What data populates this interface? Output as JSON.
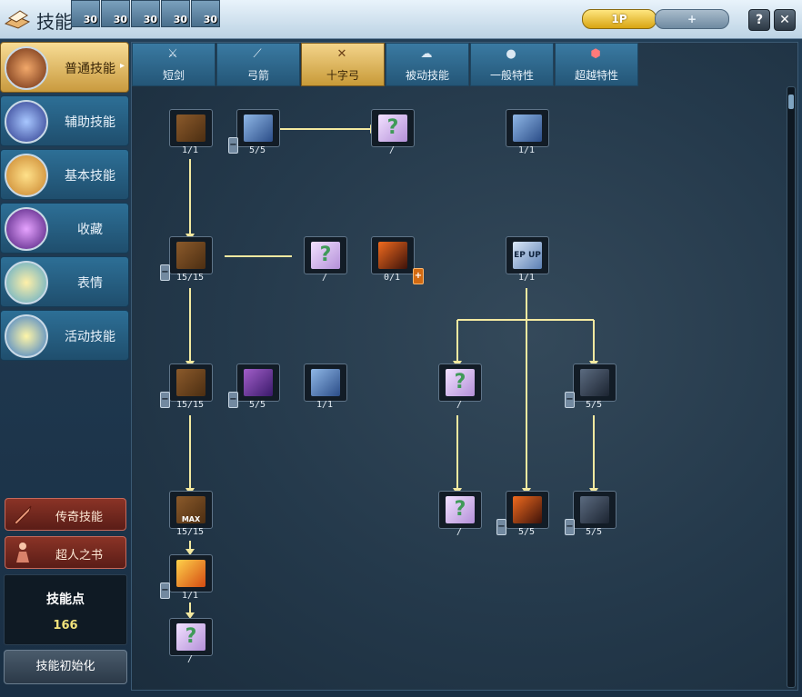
{
  "window": {
    "title": "技能",
    "badges": [
      "30",
      "30",
      "30",
      "30",
      "30"
    ],
    "page_buttons": [
      "1P",
      "+"
    ],
    "help": "?",
    "close": "✕"
  },
  "nav": [
    {
      "label": "普通技能",
      "active": true,
      "arrow": "▸"
    },
    {
      "label": "辅助技能",
      "active": false
    },
    {
      "label": "基本技能",
      "active": false
    },
    {
      "label": "收藏",
      "active": false
    },
    {
      "label": "表情",
      "active": false
    },
    {
      "label": "活动技能",
      "active": false
    }
  ],
  "special_buttons": [
    "传奇技能",
    "超人之书"
  ],
  "skill_points": {
    "title": "技能点",
    "value": "166"
  },
  "reset_button": "技能初始化",
  "tabs": [
    {
      "label": "短剑",
      "icon": "dagger-icon"
    },
    {
      "label": "弓箭",
      "icon": "bow-icon"
    },
    {
      "label": "十字弓",
      "icon": "crossbow-icon",
      "active": true
    },
    {
      "label": "被动技能",
      "icon": "cloud-icon"
    },
    {
      "label": "一般特性",
      "icon": "orb-icon"
    },
    {
      "label": "超越特性",
      "icon": "shield-icon"
    }
  ],
  "skills": [
    {
      "level": "1/1"
    },
    {
      "level": "5/5"
    },
    {
      "level": "/"
    },
    {
      "level": "1/1"
    },
    {
      "level": "15/15"
    },
    {
      "level": "/"
    },
    {
      "level": "0/1"
    },
    {
      "level": "1/1"
    },
    {
      "level": "15/15"
    },
    {
      "level": "5/5"
    },
    {
      "level": "1/1"
    },
    {
      "level": "/"
    },
    {
      "level": "5/5"
    },
    {
      "level": "15/15"
    },
    {
      "level": "/"
    },
    {
      "level": "5/5"
    },
    {
      "level": "5/5"
    },
    {
      "level": "1/1"
    },
    {
      "level": "/"
    }
  ],
  "icons": {
    "ep": "EP UP",
    "max": "MAX",
    "question": "?",
    "minus": "−",
    "plus": "+"
  }
}
